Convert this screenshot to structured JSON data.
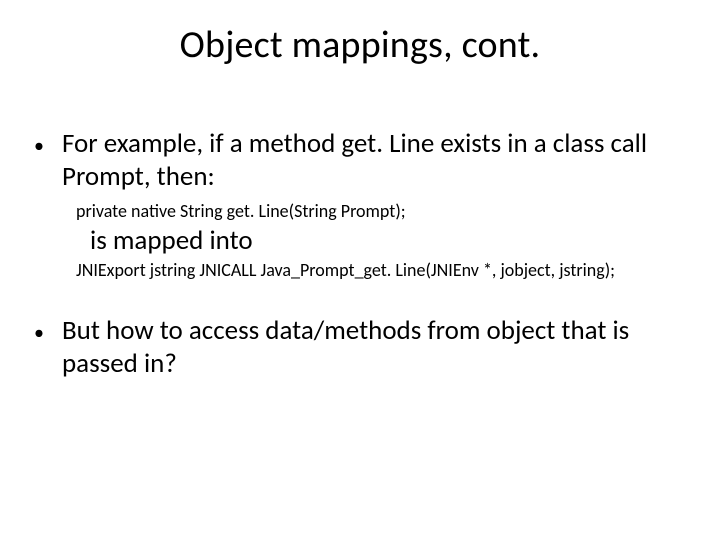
{
  "title": "Object mappings, cont.",
  "bullets": {
    "b1": {
      "text": "For example, if a method get. Line exists in a class call Prompt, then:",
      "code_java": "private native String get. Line(String Prompt);",
      "mapped_label": "is mapped into",
      "code_c": "JNIExport jstring JNICALL Java_Prompt_get. Line(JNIEnv *, jobject, jstring);"
    },
    "b2": {
      "text": "But how to access data/methods from object that is passed in?"
    }
  }
}
